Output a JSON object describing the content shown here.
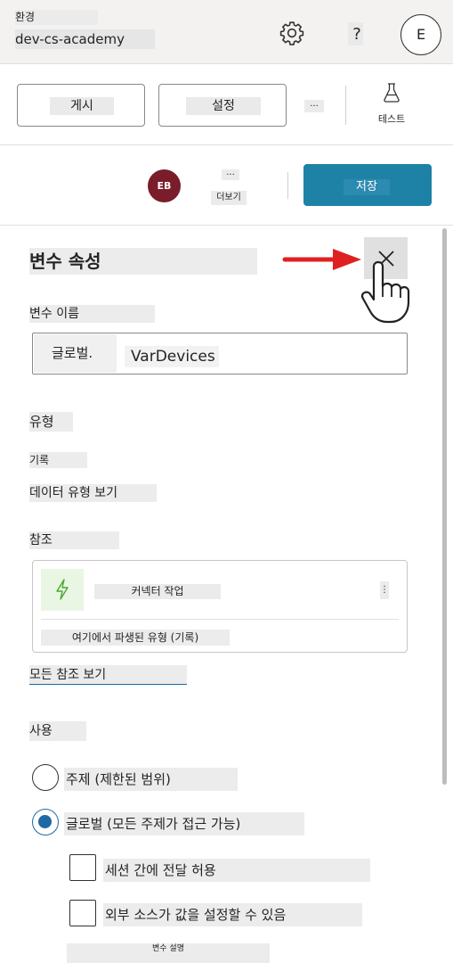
{
  "header": {
    "env_label": "환경",
    "env_name": "dev-cs-academy",
    "help_glyph": "?",
    "user_initial": "E"
  },
  "commands": {
    "publish_label": "게시",
    "settings_label": "설정",
    "more_glyph": "...",
    "test_label": "테스트"
  },
  "save_row": {
    "avatar_initials": "EB",
    "more_glyph": "...",
    "more_label": "더보기",
    "save_label": "저장"
  },
  "panel": {
    "title": "변수 속성",
    "name_label": "변수 이름",
    "name_prefix": "글로벌.",
    "name_value": "VarDevices",
    "type_label": "유형",
    "type_value": "기록",
    "view_type_link": "데이터 유형 보기",
    "references_label": "참조",
    "reference_item": {
      "title": "커넥터 작업",
      "menu_glyph": "⋮",
      "derived": "여기에서 파생된 유형 (기록)"
    },
    "all_refs_link": "모든 참조 보기",
    "usage_label": "사용",
    "usage_options": [
      {
        "label": "주제 (제한된 범위)",
        "selected": false
      },
      {
        "label": "글로벌 (모든 주제가 접근 가능)",
        "selected": true
      }
    ],
    "checkboxes": [
      {
        "label": "세션 간에 전달 허용",
        "checked": false
      },
      {
        "label": "외부 소스가 값을 설정할 수 있음",
        "checked": false
      }
    ],
    "description_label": "변수 설명"
  },
  "colors": {
    "accent": "#1e6aa6",
    "save_button": "#1e82a6",
    "avatar": "#7a1c2a",
    "annotation_arrow": "#e02020"
  },
  "icons": [
    "gear-icon",
    "help-icon",
    "flask-icon",
    "close-icon",
    "lightning-icon",
    "pointer-hand-icon",
    "arrow-icon"
  ]
}
